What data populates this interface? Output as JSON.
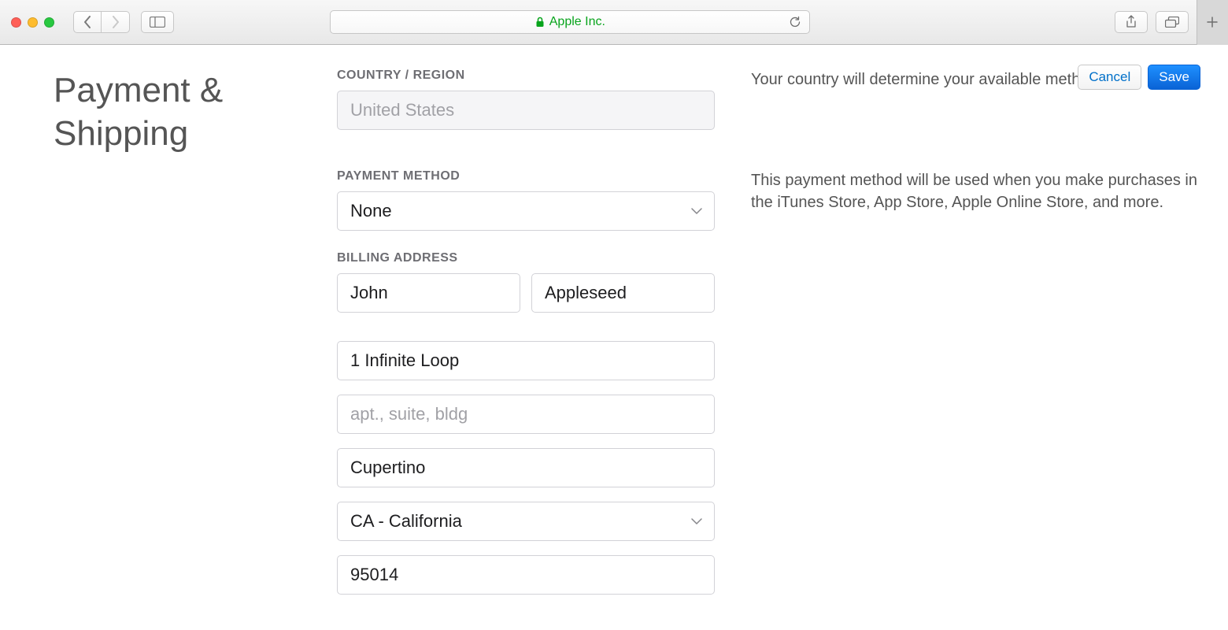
{
  "browser": {
    "site_name": "Apple Inc."
  },
  "header": {
    "title": "Payment & Shipping"
  },
  "actions": {
    "cancel_label": "Cancel",
    "save_label": "Save"
  },
  "sections": {
    "country": {
      "label": "COUNTRY / REGION",
      "value": "United States",
      "help": "Your country will determine your available methods."
    },
    "payment_method": {
      "label": "PAYMENT METHOD",
      "selected": "None",
      "help": "This payment method will be used when you make purchases in the iTunes Store, App Store, Apple Online Store, and more."
    },
    "billing_address": {
      "label": "BILLING ADDRESS",
      "first_name": "John",
      "last_name": "Appleseed",
      "street1": "1 Infinite Loop",
      "street2_placeholder": "apt., suite, bldg",
      "city": "Cupertino",
      "state_selected": "CA - California",
      "postal_code": "95014"
    }
  }
}
